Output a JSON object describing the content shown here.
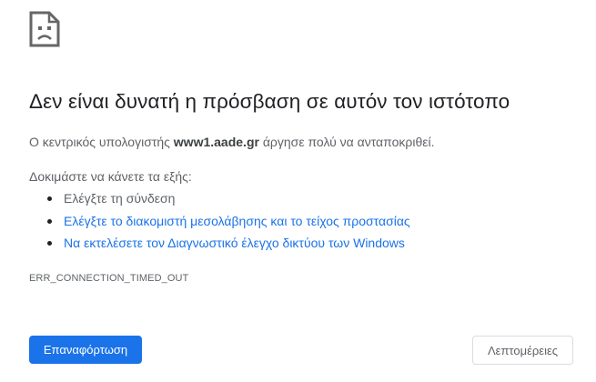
{
  "error_page": {
    "icon": "sad-page-icon",
    "title": "Δεν είναι δυνατή η πρόσβαση σε αυτόν τον ιστότοπο",
    "message": {
      "prefix": "Ο κεντρικός υπολογιστής ",
      "host": "www1.aade.gr",
      "suffix": " άργησε πολύ να ανταποκριθεί."
    },
    "suggestions_heading": "Δοκιμάστε να κάνετε τα εξής:",
    "suggestions": [
      {
        "label": "Ελέγξτε τη σύνδεση",
        "is_link": false
      },
      {
        "label": "Ελέγξτε το διακομιστή μεσολάβησης και το τείχος προστασίας",
        "is_link": true
      },
      {
        "label": "Να εκτελέσετε τον Διαγνωστικό έλεγχο δικτύου των Windows",
        "is_link": true
      }
    ],
    "error_code": "ERR_CONNECTION_TIMED_OUT",
    "reload_button": "Επαναφόρτωση",
    "details_button": "Λεπτομέρειες"
  },
  "colors": {
    "accent": "#1a73e8",
    "text_primary": "#202124",
    "text_secondary": "#5f6368",
    "icon": "#666666"
  }
}
